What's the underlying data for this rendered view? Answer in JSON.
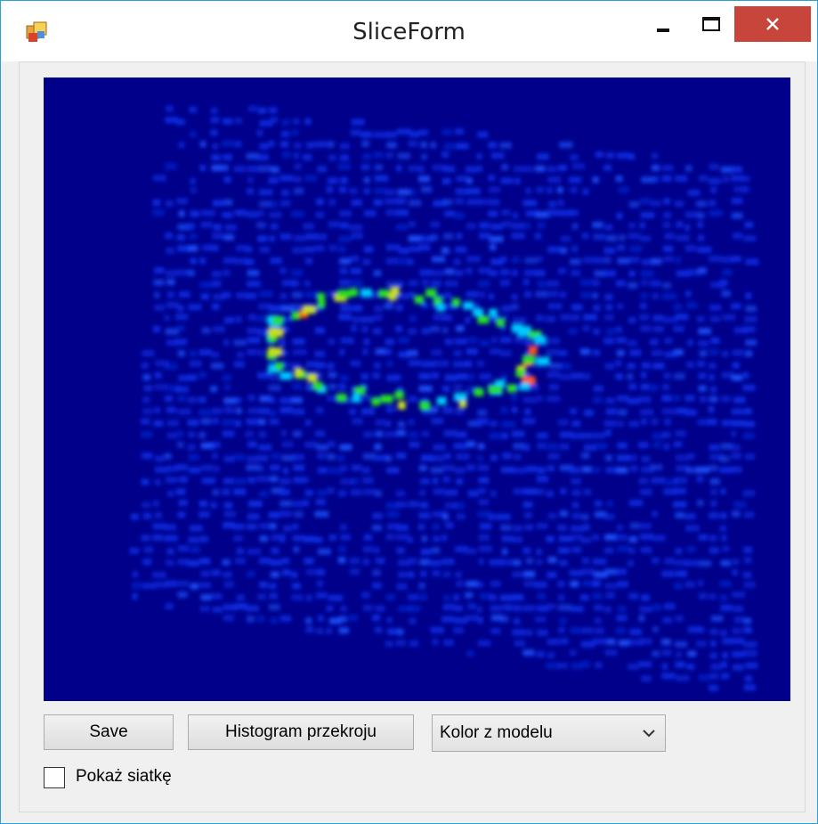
{
  "window": {
    "title": "SliceForm",
    "icon": "form-app-icon",
    "controls": {
      "minimize": "minimize-icon",
      "maximize": "maximize-icon",
      "close": "close-icon"
    }
  },
  "slice": {
    "description_icon": "slice-heatmap",
    "colors": {
      "background": "#00008a",
      "low": "#0b2fe8",
      "mid": "#00c8ff",
      "high": "#27e020",
      "peak": "#ff5500"
    }
  },
  "toolbar": {
    "save_label": "Save",
    "histogram_label": "Histogram przekroju",
    "color_mode": {
      "selected": "Kolor z modelu"
    },
    "show_grid": {
      "label": "Pokaż siatkę",
      "checked": false
    }
  }
}
